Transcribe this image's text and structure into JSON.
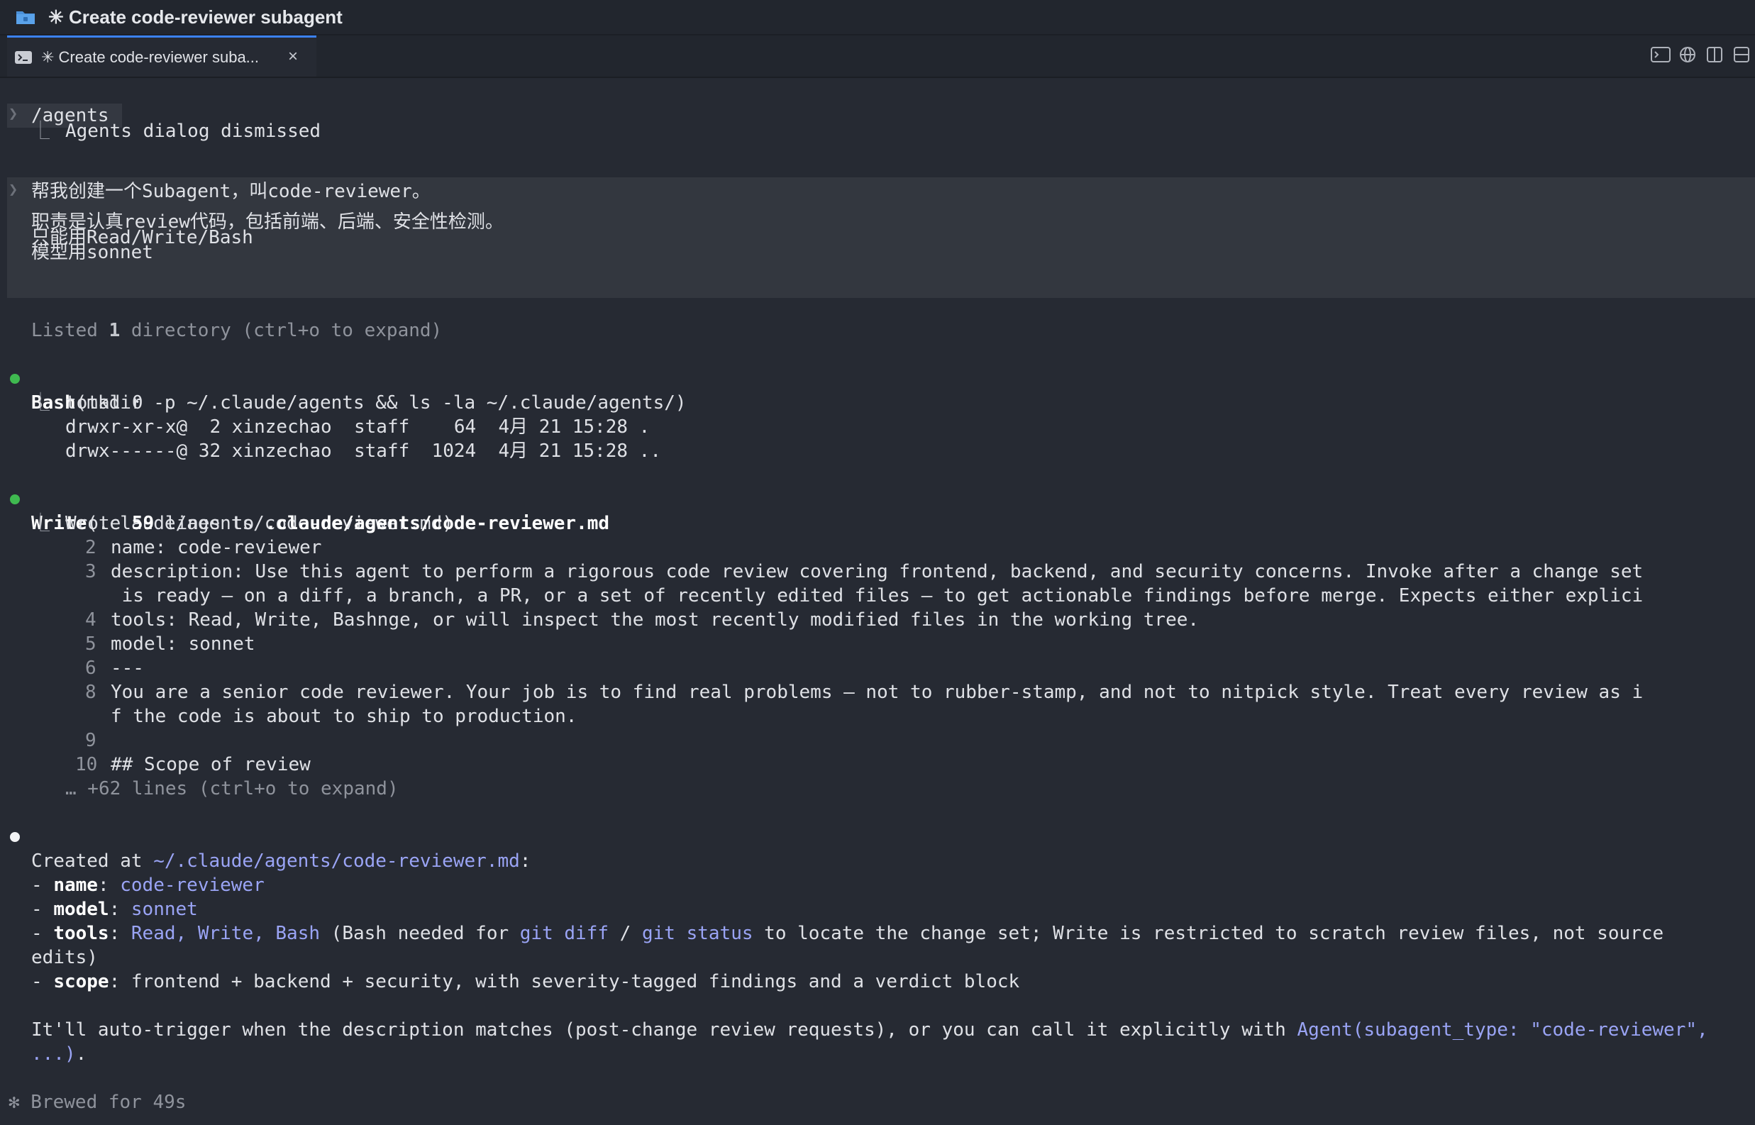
{
  "window": {
    "title": "✳ Create code-reviewer subagent"
  },
  "tab": {
    "label": "✳ Create code-reviewer suba...",
    "close": "×"
  },
  "icons": [
    "terminal-icon",
    "globe-icon",
    "split-vertical-icon",
    "split-horizontal-icon"
  ],
  "terminal": {
    "cmd1": "/agents",
    "cmd1_result": "Agents dialog dismissed",
    "prompt": [
      "帮我创建一个Subagent，叫code-reviewer。",
      "",
      "职责是认真review代码，包括前端、后端、安全性检测。",
      "只能用Read/Write/Bash",
      "模型用sonnet"
    ],
    "listed_prefix": "Listed ",
    "listed_count": "1",
    "listed_suffix": " directory (ctrl+o to expand)",
    "bash_tool": "Bash",
    "bash_args": "(mkdir -p ~/.claude/agents && ls -la ~/.claude/agents/)",
    "bash_out": [
      "total 0",
      "drwxr-xr-x@  2 xinzechao  staff    64  4月 21 15:28 .",
      "drwx------@ 32 xinzechao  staff  1024  4月 21 15:28 .."
    ],
    "write_tool": "Write",
    "write_args": "(.claude/agents/code-reviewer.md)",
    "write_summary_pre": "Wrote ",
    "write_summary_count": "59",
    "write_summary_mid": " lines to ",
    "write_summary_path": ".claude/agents/code-reviewer.md",
    "file_lines": [
      {
        "n": "2",
        "text": "name: code-reviewer"
      },
      {
        "n": "3",
        "text": "description: Use this agent to perform a rigorous code review covering frontend, backend, and security concerns. Invoke after a change set"
      },
      {
        "n": "",
        "text": " is ready — on a diff, a branch, a PR, or a set of recently edited files — to get actionable findings before merge. Expects either explici"
      },
      {
        "n": "4",
        "text": "tools: Read, Write, Bashnge, or will inspect the most recently modified files in the working tree."
      },
      {
        "n": "5",
        "text": "model: sonnet"
      },
      {
        "n": "6",
        "text": "---"
      },
      {
        "n": "8",
        "text": "You are a senior code reviewer. Your job is to find real problems — not to rubber-stamp, and not to nitpick style. Treat every review as i"
      },
      {
        "n": "",
        "text": "f the code is about to ship to production."
      },
      {
        "n": "9",
        "text": ""
      },
      {
        "n": "10",
        "text": "## Scope of review"
      }
    ],
    "more_lines": "… +62 lines (ctrl+o to expand)",
    "created_pre": "Created at ",
    "created_path": "~/.claude/agents/code-reviewer.md",
    "created_post": ":",
    "summary": {
      "name_key": "name",
      "name_val": "code-reviewer",
      "model_key": "model",
      "model_val": "sonnet",
      "tools_key": "tools",
      "tools_val": "Read, Write, Bash",
      "tools_note_1": " (Bash needed for ",
      "tools_git_diff": "git diff",
      "tools_sep": " / ",
      "tools_git_status": "git status",
      "tools_note_2": " to locate the change set; Write is restricted to scratch review files, not source",
      "tools_note_3": "edits)",
      "scope_key": "scope",
      "scope_val": ": frontend + backend + security, with severity-tagged findings and a verdict block"
    },
    "auto_pre": "It'll auto-trigger when the description matches (post-change review requests), or you can call it explicitly with ",
    "auto_code": "Agent(subagent_type: \"code-reviewer\",",
    "auto_code2": "...)",
    "auto_end": ".",
    "brewed": "✻ Brewed for 49s"
  }
}
